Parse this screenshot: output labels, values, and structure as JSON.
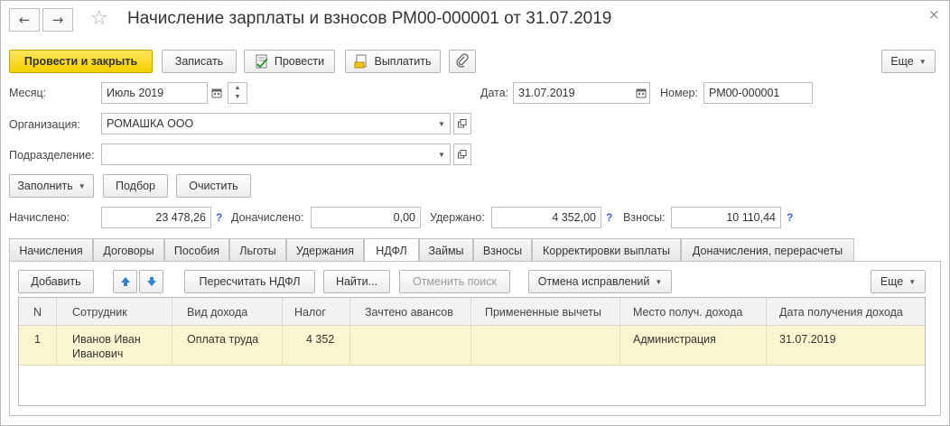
{
  "window": {
    "title": "Начисление зарплаты и взносов РМ00-000001 от 31.07.2019",
    "back_icon": "arrow-left-icon",
    "forward_icon": "arrow-right-icon",
    "favorite_icon": "star-icon",
    "close_icon": "close-icon"
  },
  "toolbar": {
    "post_close": "Провести и закрыть",
    "save": "Записать",
    "post": "Провести",
    "pay": "Выплатить",
    "more": "Еще"
  },
  "form": {
    "month_label": "Месяц:",
    "month_value": "Июль 2019",
    "date_label": "Дата:",
    "date_value": "31.07.2019",
    "number_label": "Номер:",
    "number_value": "РМ00-000001",
    "org_label": "Организация:",
    "org_value": "РОМАШКА ООО",
    "dept_label": "Подразделение:",
    "dept_value": ""
  },
  "actions": {
    "fill": "Заполнить",
    "select": "Подбор",
    "clear": "Очистить"
  },
  "totals": {
    "accrued_label": "Начислено:",
    "accrued_value": "23 478,26",
    "extra_label": "Доначислено:",
    "extra_value": "0,00",
    "withheld_label": "Удержано:",
    "withheld_value": "4 352,00",
    "contrib_label": "Взносы:",
    "contrib_value": "10 110,44",
    "help_mark": "?"
  },
  "tabs": [
    "Начисления",
    "Договоры",
    "Пособия",
    "Льготы",
    "Удержания",
    "НДФЛ",
    "Займы",
    "Взносы",
    "Корректировки выплаты",
    "Доначисления, перерасчеты"
  ],
  "active_tab": "НДФЛ",
  "tab_toolbar": {
    "add": "Добавить",
    "recalc": "Пересчитать НДФЛ",
    "find": "Найти...",
    "cancel_search": "Отменить поиск",
    "cancel_fix": "Отмена исправлений",
    "more": "Еще"
  },
  "table": {
    "columns": [
      "N",
      "Сотрудник",
      "Вид дохода",
      "Налог",
      "Зачтено авансов",
      "Примененные вычеты",
      "Место получ. дохода",
      "Дата получения дохода"
    ],
    "rows": [
      {
        "n": "1",
        "employee": "Иванов Иван Иванович",
        "income_type": "Оплата труда",
        "tax": "4 352",
        "advances": "",
        "deductions": "",
        "place": "Администрация",
        "date": "31.07.2019"
      }
    ]
  },
  "colors": {
    "primary_button": "#f4cf00",
    "selected_row": "#fbf6cf",
    "help_mark": "#3a6ecf",
    "arrow_blue": "#2f7fd1"
  }
}
